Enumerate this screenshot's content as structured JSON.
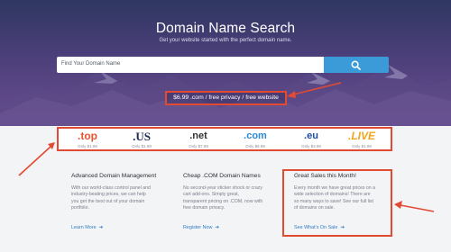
{
  "hero": {
    "title": "Domain Name Search",
    "subtitle": "Get your website started with the perfect domain name."
  },
  "search": {
    "placeholder": "Find Your Domain Name",
    "button_icon": "search-icon"
  },
  "promo": {
    "text": "$6.99 .com / free privacy / free website"
  },
  "tlds": [
    {
      "name": ".top",
      "price": "Only $1.99"
    },
    {
      "name": ".US",
      "price": "Only $1.99"
    },
    {
      "name": ".net",
      "price": "Only $7.88"
    },
    {
      "name": ".com",
      "price": "Only $6.99"
    },
    {
      "name": ".eu",
      "price": "Only $3.99"
    },
    {
      "name": ".LIVE",
      "price": "Only $1.99"
    }
  ],
  "features": [
    {
      "title": "Advanced Domain Management",
      "lines": [
        "With our world-class control panel and",
        "industry-beating prices, we can help",
        "you get the best out of your domain",
        "portfolio."
      ],
      "link": "Learn More"
    },
    {
      "title": "Cheap .COM Domain Names",
      "lines": [
        "No second-year sticker shock or crazy",
        "cart add-ons. Simply great,",
        "transparent pricing on .COM, now with",
        "free domain privacy."
      ],
      "link": "Register Now"
    },
    {
      "title": "Great Sales this Month!",
      "lines": [
        "Every month we have great prices on a",
        "wide selection of domains! There are",
        "so many ways to save! See our full list",
        "of domains on sale."
      ],
      "link": "See What's On Sale"
    }
  ],
  "colors": {
    "annotation": "#e34a32",
    "search_button": "#3b9bd8",
    "link": "#2f7cc4"
  }
}
